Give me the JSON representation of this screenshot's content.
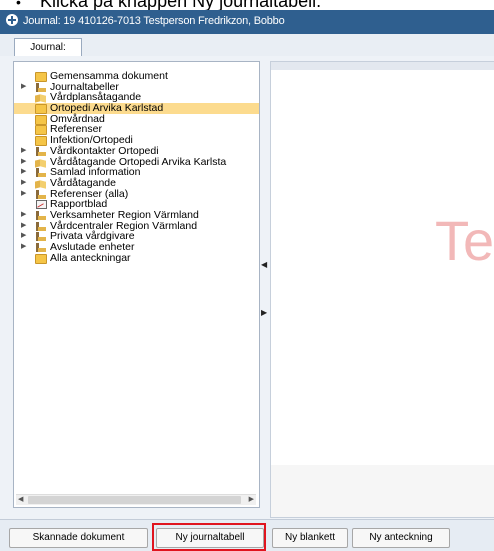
{
  "caption": {
    "bullet": "•",
    "text": "Klicka på knappen Ny journaltabell."
  },
  "window": {
    "title": "Journal: 19 410126-7013 Testperson Fredrikzon, Bobbo"
  },
  "tabs": [
    {
      "label": "Journal:"
    }
  ],
  "tree": {
    "items": [
      {
        "label": "Gemensamma dokument",
        "icon": "folder-icon",
        "expandable": false
      },
      {
        "label": "Journaltabeller",
        "icon": "ledger-icon",
        "expandable": true
      },
      {
        "label": "Vårdplansåtagande",
        "icon": "open-folder-icon",
        "expandable": false
      },
      {
        "label": "Ortopedi Arvika Karlstad",
        "icon": "folder-icon",
        "expandable": false,
        "selected": true
      },
      {
        "label": "Omvårdnad",
        "icon": "folder-icon",
        "expandable": false
      },
      {
        "label": "Referenser",
        "icon": "folder-icon",
        "expandable": false
      },
      {
        "label": "Infektion/Ortopedi",
        "icon": "folder-icon",
        "expandable": false
      },
      {
        "label": "Vårdkontakter Ortopedi",
        "icon": "ledger-icon",
        "expandable": true
      },
      {
        "label": "Vårdåtagande Ortopedi Arvika Karlsta",
        "icon": "open-folder-icon",
        "expandable": true
      },
      {
        "label": "Samlad information",
        "icon": "ledger-icon",
        "expandable": true
      },
      {
        "label": "Vårdåtagande",
        "icon": "open-folder-icon",
        "expandable": true
      },
      {
        "label": "Referenser (alla)",
        "icon": "ledger-icon",
        "expandable": true
      },
      {
        "label": "Rapportblad",
        "icon": "report-icon",
        "expandable": false
      },
      {
        "label": "Verksamheter Region Värmland",
        "icon": "ledger-icon",
        "expandable": true
      },
      {
        "label": "Vårdcentraler Region Värmland",
        "icon": "ledger-icon",
        "expandable": true
      },
      {
        "label": "Privata vårdgivare",
        "icon": "ledger-icon",
        "expandable": true
      },
      {
        "label": "Avslutade enheter",
        "icon": "ledger-icon",
        "expandable": true
      },
      {
        "label": "Alla anteckningar",
        "icon": "folder-icon",
        "expandable": false
      }
    ]
  },
  "watermark": {
    "text": "Te"
  },
  "buttons": {
    "scanned": "Skannade dokument",
    "new_journal_table": "Ny journaltabell",
    "new_form": "Ny blankett",
    "new_note": "Ny anteckning"
  }
}
